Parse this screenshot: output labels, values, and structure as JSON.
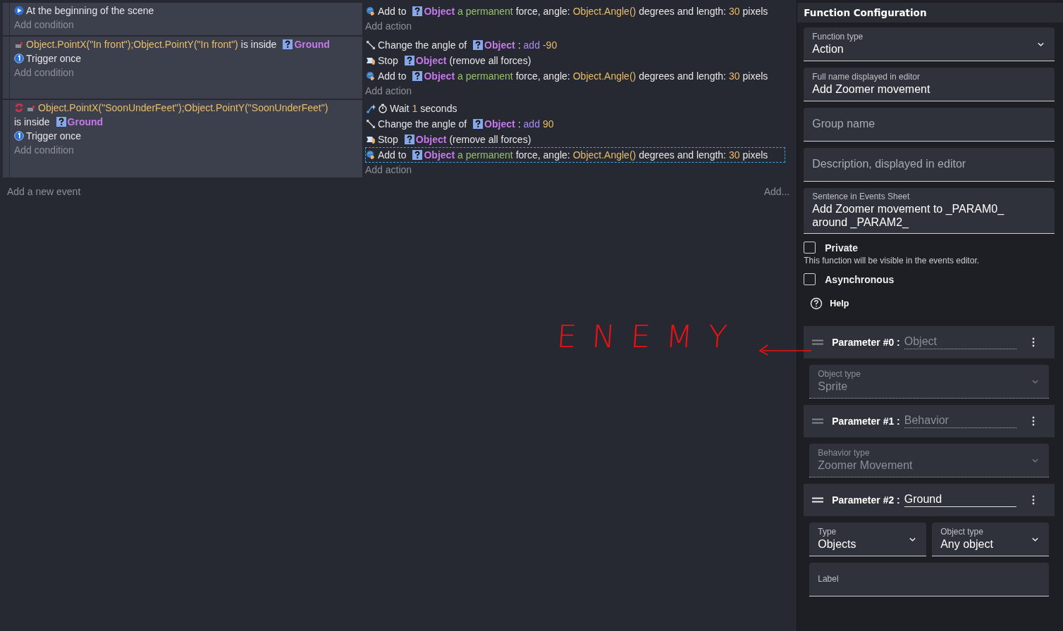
{
  "events": [
    {
      "conditions": [
        {
          "kind": "scene-start",
          "parts": [
            {
              "kind": "text",
              "text": "At the beginning of the scene"
            }
          ]
        }
      ],
      "add_condition": "Add condition",
      "actions": [
        {
          "kind": "force",
          "selected": false,
          "parts": [
            {
              "kind": "text",
              "text": "Add to"
            },
            {
              "kind": "object",
              "text": "Object"
            },
            {
              "kind": "keyword",
              "text": "a permanent"
            },
            {
              "kind": "text",
              "text": "force, angle:"
            },
            {
              "kind": "expr",
              "text": "Object.Angle()"
            },
            {
              "kind": "text",
              "text": "degrees and length:"
            },
            {
              "kind": "expr",
              "text": "30"
            },
            {
              "kind": "text",
              "text": "pixels"
            }
          ]
        }
      ],
      "add_action": "Add action"
    },
    {
      "conditions": [
        {
          "kind": "collision",
          "parts": [
            {
              "kind": "expr",
              "text": "Object.PointX(\"In front\");Object.PointY(\"In front\")"
            },
            {
              "kind": "text",
              "text": "is inside"
            },
            {
              "kind": "object",
              "text": "Ground"
            }
          ]
        },
        {
          "kind": "trigger-once",
          "parts": [
            {
              "kind": "text",
              "text": "Trigger once"
            }
          ]
        }
      ],
      "add_condition": "Add condition",
      "actions": [
        {
          "kind": "rotate",
          "selected": false,
          "parts": [
            {
              "kind": "text",
              "text": "Change the angle of"
            },
            {
              "kind": "object",
              "text": "Object"
            },
            {
              "kind": "text",
              "text": ":"
            },
            {
              "kind": "op",
              "text": "add"
            },
            {
              "kind": "expr",
              "text": "-90"
            }
          ]
        },
        {
          "kind": "stop",
          "selected": false,
          "parts": [
            {
              "kind": "text",
              "text": "Stop"
            },
            {
              "kind": "object",
              "text": "Object"
            },
            {
              "kind": "text",
              "text": "(remove all forces)"
            }
          ]
        },
        {
          "kind": "force",
          "selected": false,
          "parts": [
            {
              "kind": "text",
              "text": "Add to"
            },
            {
              "kind": "object",
              "text": "Object"
            },
            {
              "kind": "keyword",
              "text": "a permanent"
            },
            {
              "kind": "text",
              "text": "force, angle:"
            },
            {
              "kind": "expr",
              "text": "Object.Angle()"
            },
            {
              "kind": "text",
              "text": "degrees and length:"
            },
            {
              "kind": "expr",
              "text": "30"
            },
            {
              "kind": "text",
              "text": "pixels"
            }
          ]
        }
      ],
      "add_action": "Add action"
    },
    {
      "conditions": [
        {
          "kind": "collision-repeat",
          "parts": [
            {
              "kind": "expr",
              "text": "Object.PointX(\"SoonUnderFeet\");Object.PointY(\"SoonUnderFeet\")"
            },
            {
              "kind": "text",
              "text": "is inside"
            },
            {
              "kind": "object",
              "text": "Ground"
            }
          ]
        },
        {
          "kind": "trigger-once",
          "parts": [
            {
              "kind": "text",
              "text": "Trigger once"
            }
          ]
        }
      ],
      "add_condition": "Add condition",
      "actions": [
        {
          "kind": "wait",
          "selected": false,
          "parts": [
            {
              "kind": "text",
              "text": "Wait"
            },
            {
              "kind": "expr",
              "text": "1"
            },
            {
              "kind": "text",
              "text": "seconds"
            }
          ]
        },
        {
          "kind": "rotate",
          "selected": false,
          "parts": [
            {
              "kind": "text",
              "text": "Change the angle of"
            },
            {
              "kind": "object",
              "text": "Object"
            },
            {
              "kind": "text",
              "text": ":"
            },
            {
              "kind": "op",
              "text": "add"
            },
            {
              "kind": "expr",
              "text": "90"
            }
          ]
        },
        {
          "kind": "stop",
          "selected": false,
          "parts": [
            {
              "kind": "text",
              "text": "Stop"
            },
            {
              "kind": "object",
              "text": "Object"
            },
            {
              "kind": "text",
              "text": "(remove all forces)"
            }
          ]
        },
        {
          "kind": "force",
          "selected": true,
          "parts": [
            {
              "kind": "text",
              "text": "Add to"
            },
            {
              "kind": "object",
              "text": "Object"
            },
            {
              "kind": "keyword",
              "text": "a permanent"
            },
            {
              "kind": "text",
              "text": "force, angle:"
            },
            {
              "kind": "expr",
              "text": "Object.Angle()"
            },
            {
              "kind": "text",
              "text": "degrees and length:"
            },
            {
              "kind": "expr",
              "text": "30"
            },
            {
              "kind": "text",
              "text": "pixels"
            }
          ]
        }
      ],
      "add_action": "Add action"
    }
  ],
  "add_event": "Add a new event",
  "add_menu": "Add...",
  "annotation": {
    "text": "ENEMY"
  },
  "panel": {
    "title": "Function Configuration",
    "fields": [
      {
        "kind": "select",
        "label": "Function type",
        "value": "Action"
      },
      {
        "kind": "text",
        "label": "Full name displayed in editor",
        "value": "Add Zoomer movement"
      },
      {
        "placeholder": "Group name"
      },
      {
        "placeholder": "Description, displayed in editor"
      },
      {
        "kind": "text",
        "label": "Sentence in Events Sheet",
        "value": "Add Zoomer movement to _PARAM0_ around _PARAM2_"
      }
    ],
    "checkboxes": [
      {
        "label": "Private",
        "checked": false,
        "hint": "This function will be visible in the events editor."
      },
      {
        "label": "Asynchronous",
        "checked": false
      }
    ],
    "help": "Help",
    "parameters": [
      {
        "label": "Parameter #0 :",
        "name": "Object",
        "disabled": true,
        "fields": [
          {
            "kind": "select",
            "label": "Object type",
            "value": "Sprite"
          }
        ]
      },
      {
        "label": "Parameter #1 :",
        "name": "Behavior",
        "disabled": true,
        "fields": [
          {
            "kind": "select",
            "label": "Behavior type",
            "value": "Zoomer Movement"
          }
        ]
      },
      {
        "label": "Parameter #2 :",
        "name": "Ground",
        "disabled": false,
        "fields": [
          {
            "kind": "select",
            "label": "Type",
            "value": "Objects"
          },
          {
            "kind": "select",
            "label": "Object type",
            "value": "Any object"
          },
          {
            "kind": "text",
            "label": "Label"
          }
        ]
      }
    ]
  }
}
